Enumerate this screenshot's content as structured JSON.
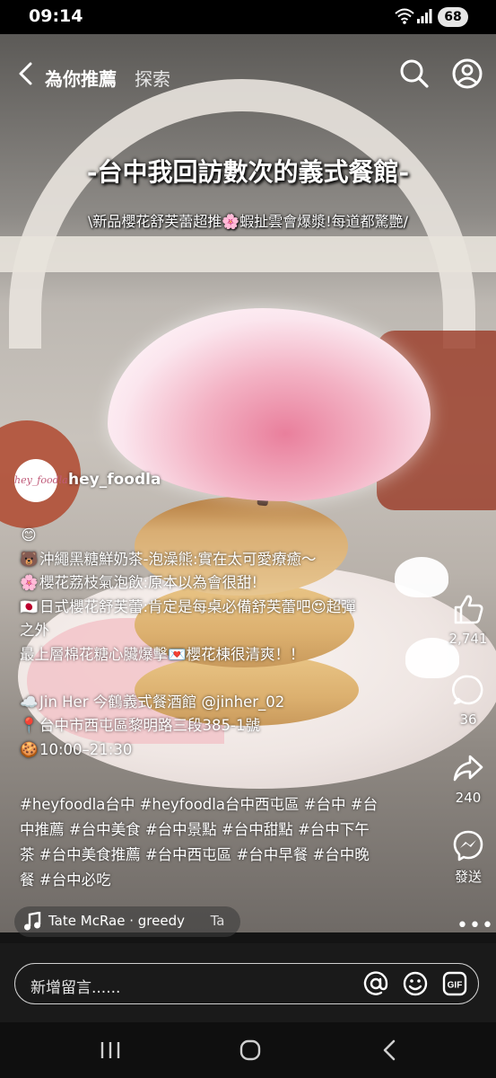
{
  "status_bar": {
    "time": "09:14",
    "battery": "68"
  },
  "nav": {
    "title": "為你推薦",
    "explore": "探索"
  },
  "overlay": {
    "headline": "-台中我回訪數次的義式餐館-",
    "subheadline": "\\新品櫻花舒芙蕾超推🌸蝦扯雲會爆漿!每道都驚艷/"
  },
  "author": {
    "avatar_text": "hey_foodla",
    "name": "hey_foodla"
  },
  "caption": {
    "lines": [
      {
        "emoji": "😊",
        "text": ""
      },
      {
        "emoji": "🐻",
        "text": "沖繩黑糖鮮奶茶-泡澡熊:實在太可愛療癒～"
      },
      {
        "emoji": "🌸",
        "text": "櫻花荔枝氣泡飲:原本以為會很甜!"
      },
      {
        "emoji": "🇯🇵",
        "text": "日式櫻花舒芙蕾:肯定是每桌必備舒芙蕾吧😍超彈"
      },
      {
        "emoji": "",
        "text": "之外"
      },
      {
        "emoji": "",
        "text": "最上層棉花糖心臟爆擊💌櫻花棟很清爽！！"
      },
      {
        "emoji": "",
        "text": ""
      },
      {
        "emoji": "☁️",
        "text": "Jin Her 今鶴義式餐酒館 @jinher_02"
      },
      {
        "emoji": "📍",
        "text": "台中市西屯區黎明路三段385-1號"
      },
      {
        "emoji": "🍪",
        "text": "10:00–21:30"
      }
    ],
    "tags": [
      "#heyfoodla台中 #heyfoodla台中西屯區 #台中 #台",
      "中推薦 #台中美食 #台中景點 #台中甜點 #台中下午",
      "茶 #台中美食推薦 #台中西屯區 #台中早餐 #台中晚",
      "餐 #台中必吃"
    ]
  },
  "actions": {
    "likes": "2,741",
    "comments": "36",
    "shares": "240",
    "send_label": "發送"
  },
  "music": {
    "text": "Tate McRae · greedy",
    "trailing": "Ta"
  },
  "comment": {
    "placeholder": "新增留言......",
    "gif_label": "GIF"
  },
  "colors": {
    "background": "#141414",
    "text": "#ffffff",
    "plate_pink": "#f2c4c9",
    "cotton_pink": "#e97f9c"
  }
}
